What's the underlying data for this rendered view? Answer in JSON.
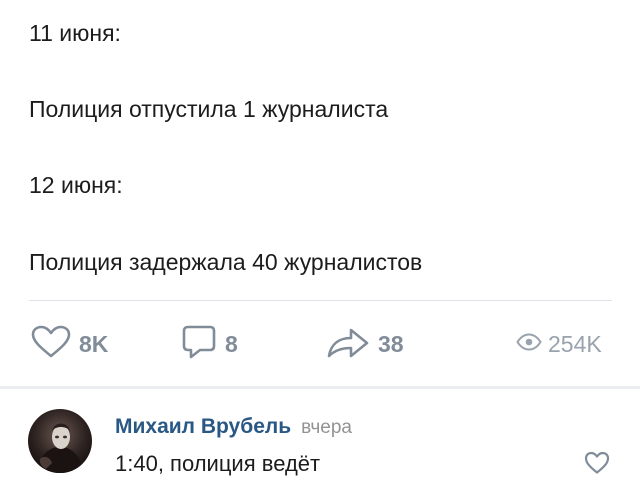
{
  "post": {
    "lines": [
      "11 июня:",
      "Полиция отпустила 1 журналиста",
      "12 июня:",
      "Полиция задержала 40 журналистов"
    ]
  },
  "actions": {
    "likes": {
      "icon": "heart-icon",
      "count": "8K"
    },
    "comments": {
      "icon": "comment-icon",
      "count": "8"
    },
    "shares": {
      "icon": "share-arrow-icon",
      "count": "38"
    },
    "views": {
      "icon": "eye-icon",
      "count": "254K"
    }
  },
  "comment": {
    "author": "Михаил Врубель",
    "time": "вчера",
    "text": "1:40, полиция ведёт",
    "like_icon": "heart-icon"
  },
  "colors": {
    "link": "#2a5885",
    "action_gray": "#818c99",
    "muted": "#99a2ad",
    "text": "#1c1c1c"
  }
}
